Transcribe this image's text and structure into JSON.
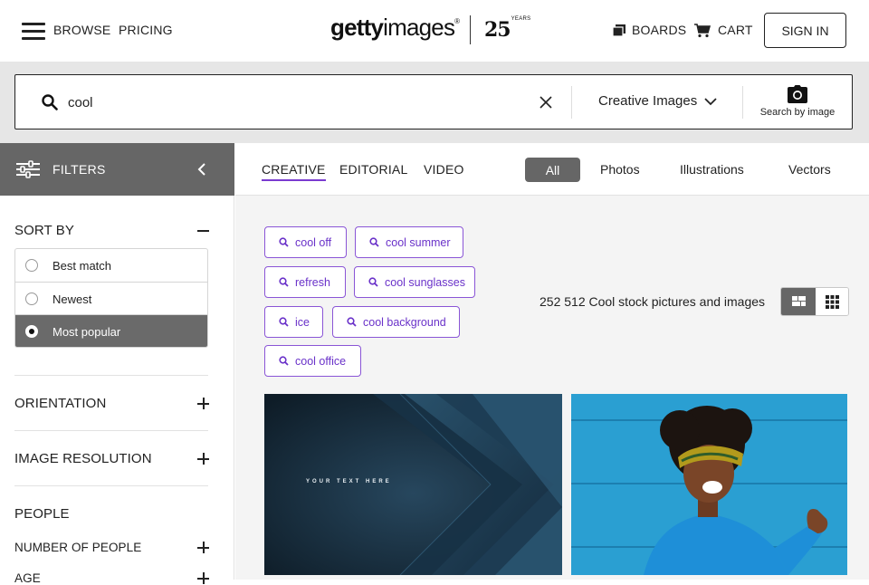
{
  "nav": {
    "browse": "BROWSE",
    "pricing": "PRICING",
    "logo_bold": "getty",
    "logo_light": "images",
    "logo_mark": "®",
    "anniversary_number": "25",
    "anniversary_word": "YEARS",
    "boards": "BOARDS",
    "cart": "CART",
    "sign_in": "SIGN IN"
  },
  "search": {
    "query": "cool",
    "image_type": "Creative Images",
    "search_by_image": "Search by image"
  },
  "filters": {
    "header": "FILTERS",
    "sort_by": "SORT BY",
    "sort_options": [
      {
        "label": "Best match",
        "selected": false
      },
      {
        "label": "Newest",
        "selected": false
      },
      {
        "label": "Most popular",
        "selected": true
      }
    ],
    "sections": [
      "ORIENTATION",
      "IMAGE RESOLUTION",
      "PEOPLE",
      "NUMBER OF PEOPLE",
      "AGE"
    ]
  },
  "content_tabs": [
    "CREATIVE",
    "EDITORIAL",
    "VIDEO"
  ],
  "active_content_tab": "CREATIVE",
  "media_tabs": [
    "All",
    "Photos",
    "Illustrations",
    "Vectors"
  ],
  "active_media_tab": "All",
  "related_searches": [
    "cool off",
    "cool summer",
    "refresh",
    "cool sunglasses",
    "ice",
    "cool background",
    "cool office"
  ],
  "results_text": "252 512 Cool stock pictures and images",
  "view_mode": "mosaic",
  "images": [
    {
      "overlay_text": "YOUR TEXT HERE"
    }
  ],
  "colors": {
    "accent": "#7a3bd0",
    "chip_text": "#6a32c9",
    "filter_bar": "#666666",
    "search_band": "#e6e6e6"
  }
}
